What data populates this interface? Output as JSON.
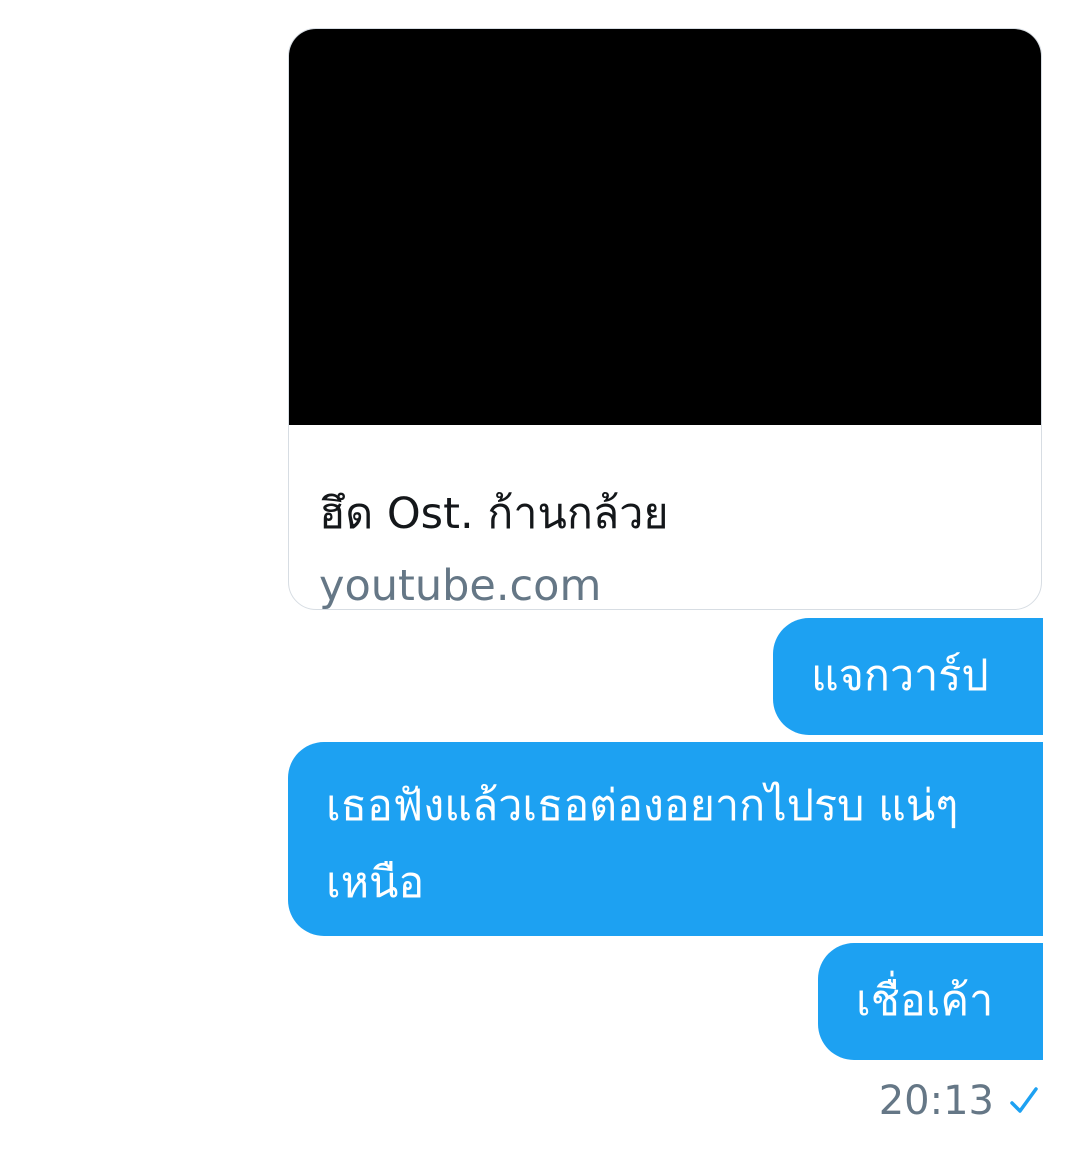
{
  "link_card": {
    "title": "ฮึด Ost. ก้านกล้วย",
    "domain": "youtube.com"
  },
  "messages": [
    {
      "text": "แจกวาร์ป"
    },
    {
      "text": "เธอฟังแล้วเธอต่องอยากไปรบ แน่ๆเหนือ"
    },
    {
      "text": "เชื่อเค้า"
    }
  ],
  "status": {
    "time": "20:13",
    "icon": "check-icon",
    "accent": "#1da1f2"
  }
}
